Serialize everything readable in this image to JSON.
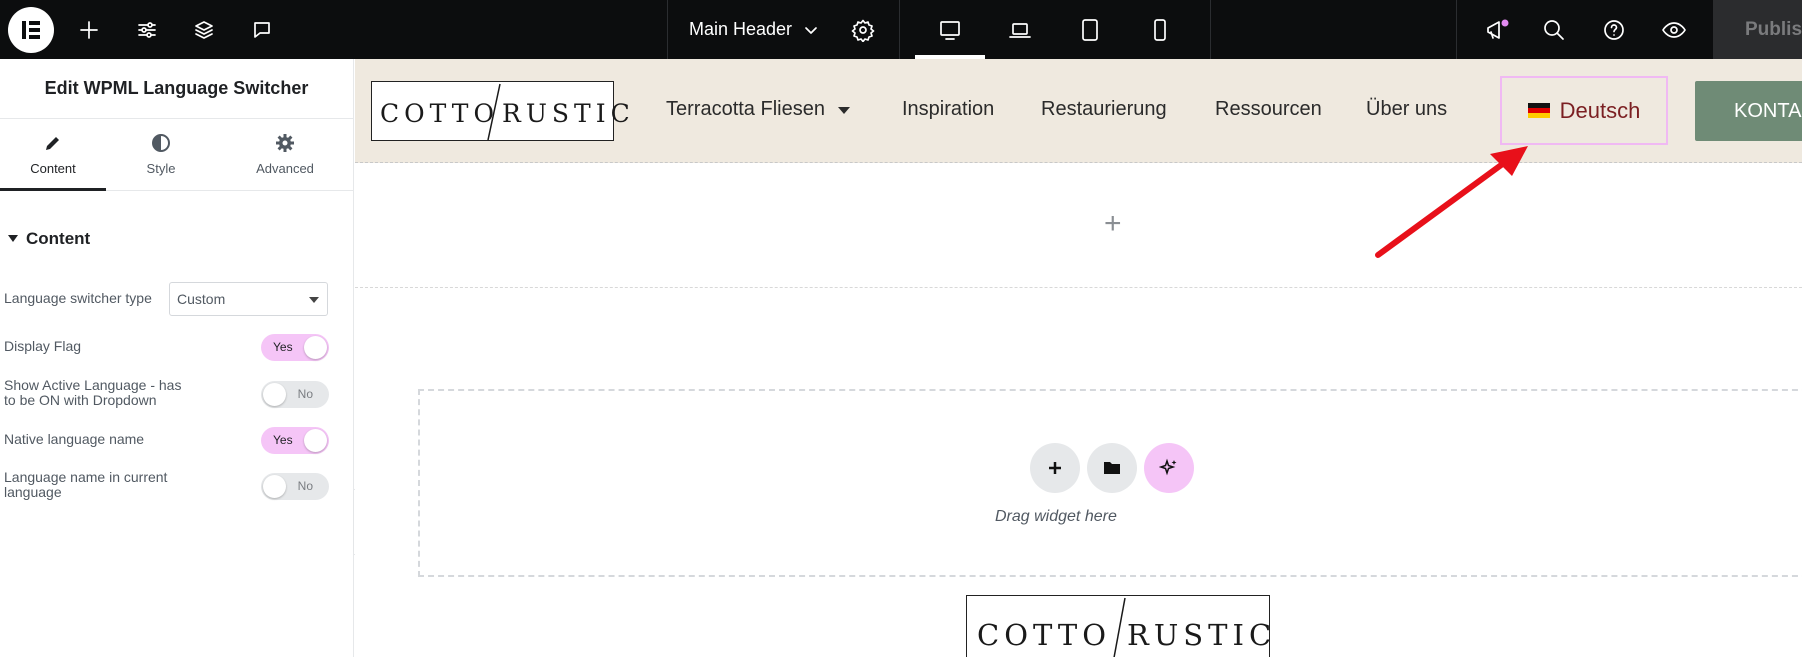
{
  "topbar": {
    "document_title": "Main Header",
    "publish_label": "Publis",
    "icons": [
      "elementor-logo-icon",
      "plus-icon",
      "sliders-icon",
      "layers-icon",
      "comment-icon",
      "chevron-down-icon",
      "gear-icon",
      "desktop-icon",
      "laptop-icon",
      "tablet-icon",
      "mobile-icon",
      "megaphone-icon",
      "search-icon",
      "help-icon",
      "eye-icon"
    ],
    "notification_color": "#e38bf0"
  },
  "panel": {
    "title": "Edit WPML Language Switcher",
    "tabs": [
      {
        "label": "Content",
        "icon": "pencil-icon",
        "active": true
      },
      {
        "label": "Style",
        "icon": "contrast-icon",
        "active": false
      },
      {
        "label": "Advanced",
        "icon": "gear-icon",
        "active": false
      }
    ],
    "section_title": "Content",
    "switcher_type": {
      "label": "Language switcher type",
      "value": "Custom"
    },
    "controls": [
      {
        "label": "Display Flag",
        "state": "Yes",
        "on": true
      },
      {
        "label_line1": "Show Active Language - has",
        "label_line2": "to be ON with Dropdown",
        "state": "No",
        "on": false
      },
      {
        "label": "Native language name",
        "state": "Yes",
        "on": true
      },
      {
        "label_line1": "Language name in current",
        "label_line2": "language",
        "state": "No",
        "on": false
      }
    ]
  },
  "site": {
    "logo_left": "COTTO",
    "logo_right": "RUSTIC",
    "nav": [
      "Terracotta Fliesen",
      "Inspiration",
      "Restaurierung",
      "Ressourcen",
      "Über uns"
    ],
    "language": "Deutsch",
    "cta": "KONTAKT",
    "header_bg": "#efe9df",
    "cta_bg": "#6f8b76"
  },
  "canvas": {
    "drag_text": "Drag widget here",
    "ai_button_color": "#f5c5f7"
  },
  "annotation": {
    "arrow_color": "#e8101a"
  }
}
